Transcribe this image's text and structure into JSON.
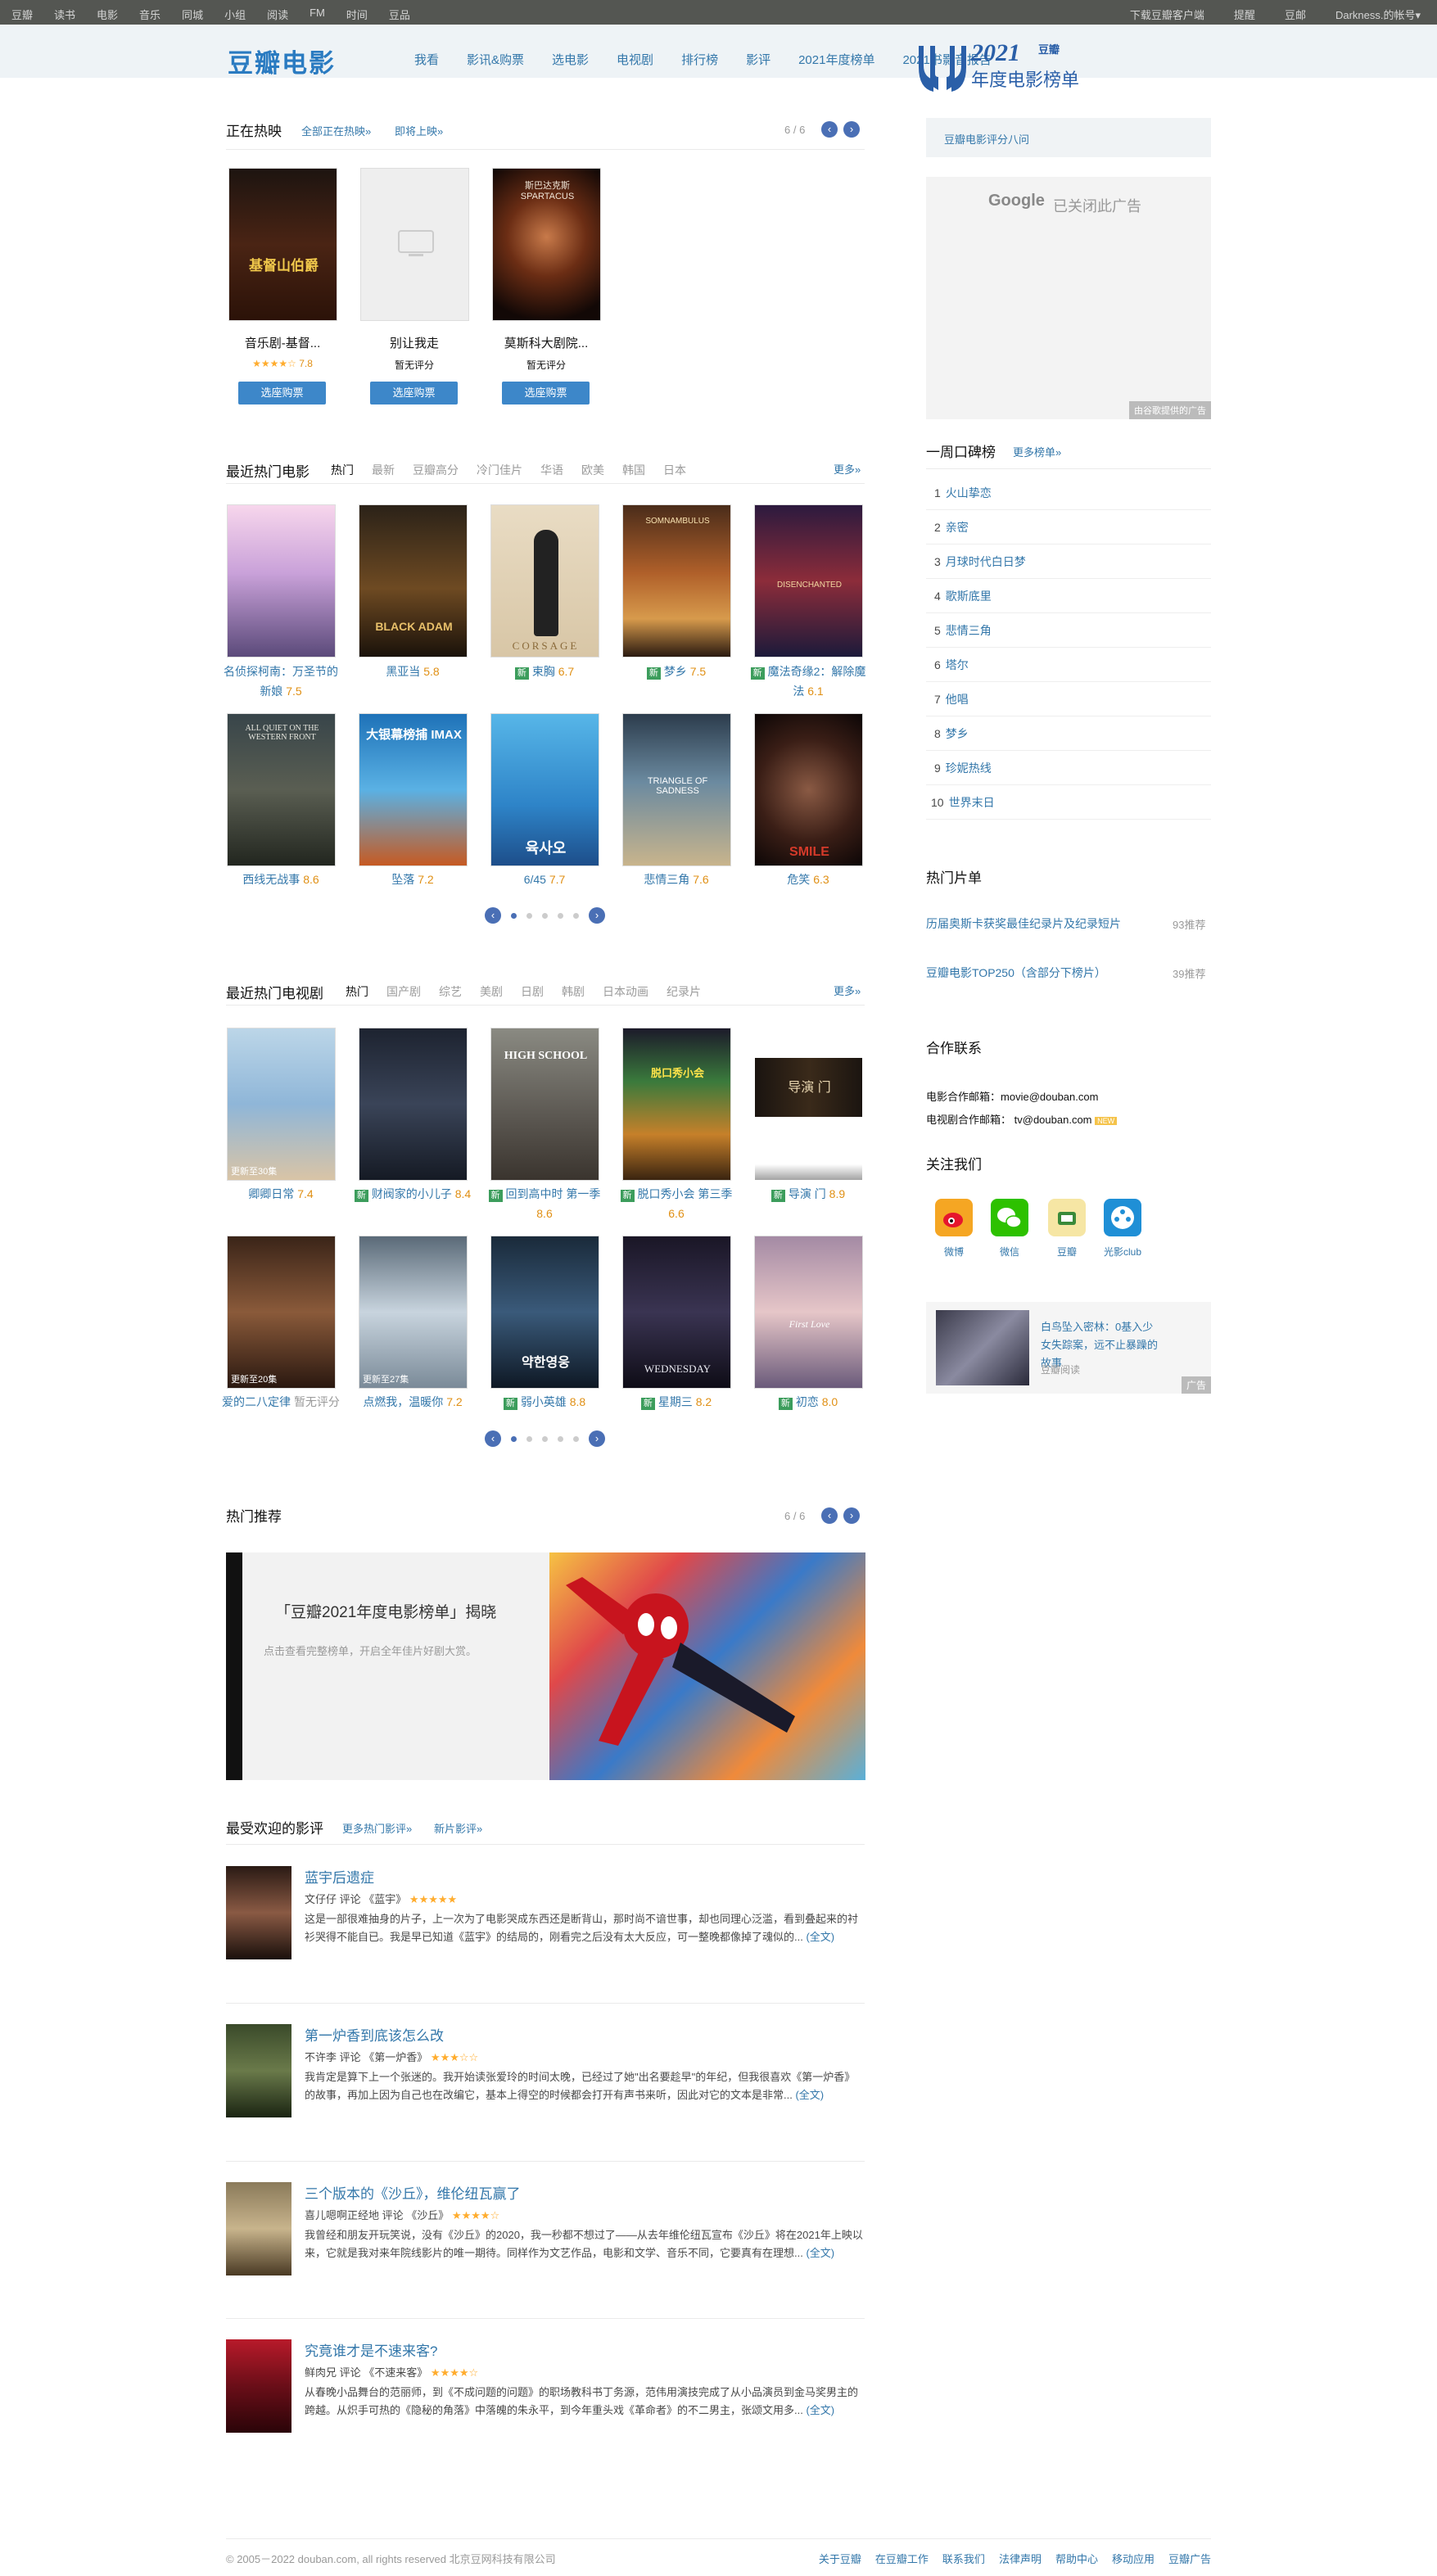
{
  "topbar": {
    "nav": [
      "豆瓣",
      "读书",
      "电影",
      "音乐",
      "同城",
      "小组",
      "阅读",
      "FM",
      "时间",
      "豆品"
    ],
    "right": [
      "下载豆瓣客户端",
      "提醒",
      "豆邮",
      "Darkness.的帐号▾"
    ]
  },
  "header": {
    "logo": "豆瓣电影",
    "nav": [
      "我看",
      "影讯&购票",
      "选电影",
      "电视剧",
      "排行榜",
      "影评",
      "2021年度榜单",
      "2021书影音报告"
    ],
    "year_logo_top": "2021",
    "year_logo_brand": "豆瓣",
    "year_logo_bottom": "年度电影榜单"
  },
  "now_playing": {
    "title": "正在热映",
    "links": [
      "全部正在热映»",
      "即将上映»"
    ],
    "pager": "6 / 6",
    "items": [
      {
        "title": "音乐剧-基督...",
        "stars": "★★★★☆",
        "rating": "7.8",
        "button": "选座购票"
      },
      {
        "title": "别让我走",
        "rating_text": "暂无评分",
        "button": "选座购票"
      },
      {
        "title": "莫斯科大剧院...",
        "rating_text": "暂无评分",
        "button": "选座购票"
      }
    ],
    "poster_texts": [
      "基督山伯爵",
      "",
      "斯巴达克斯 SPARTACUS"
    ]
  },
  "hot_movies": {
    "title": "最近热门电影",
    "tabs": [
      "热门",
      "最新",
      "豆瓣高分",
      "冷门佳片",
      "华语",
      "欧美",
      "韩国",
      "日本"
    ],
    "more": "更多»",
    "new_tag": "新",
    "items": [
      {
        "title": "名侦探柯南：万圣节的新娘",
        "rating": "7.5",
        "new": false
      },
      {
        "title": "黑亚当",
        "rating": "5.8",
        "new": false
      },
      {
        "title": "束胸",
        "rating": "6.7",
        "new": true
      },
      {
        "title": "梦乡",
        "rating": "7.5",
        "new": true
      },
      {
        "title": "魔法奇缘2：解除魔法",
        "rating": "6.1",
        "new": true
      },
      {
        "title": "西线无战事",
        "rating": "8.6",
        "new": false
      },
      {
        "title": "坠落",
        "rating": "7.2",
        "new": false
      },
      {
        "title": "6/45",
        "rating": "7.7",
        "new": false
      },
      {
        "title": "悲情三角",
        "rating": "7.6",
        "new": false
      },
      {
        "title": "危笑",
        "rating": "6.3",
        "new": false
      }
    ],
    "poster_texts": [
      "",
      "BLACK ADAM",
      "CORSAGE",
      "SOMNAMBULUS",
      "DISENCHANTED",
      "ALL QUIET ON THE WESTERN FRONT",
      "大银幕榜捕 IMAX",
      "육사오",
      "TRIANGLE OF SADNESS",
      "SMILE"
    ]
  },
  "hot_tv": {
    "title": "最近热门电视剧",
    "tabs": [
      "热门",
      "国产剧",
      "综艺",
      "美剧",
      "日剧",
      "韩剧",
      "日本动画",
      "纪录片"
    ],
    "more": "更多»",
    "new_tag": "新",
    "items": [
      {
        "title": "卿卿日常",
        "rating": "7.4",
        "new": false
      },
      {
        "title": "财阀家的小儿子",
        "rating": "8.4",
        "new": true
      },
      {
        "title": "回到高中时 第一季",
        "rating": "8.6",
        "new": true
      },
      {
        "title": "脱口秀小会 第三季",
        "rating": "6.6",
        "new": true
      },
      {
        "title": "导演 门",
        "rating": "8.9",
        "new": true
      },
      {
        "title": "爱的二八定律",
        "rating_text": "暂无评分",
        "new": false
      },
      {
        "title": "点燃我，温暖你",
        "rating": "7.2",
        "new": false
      },
      {
        "title": "弱小英雄",
        "rating": "8.8",
        "new": true
      },
      {
        "title": "星期三",
        "rating": "8.2",
        "new": true
      },
      {
        "title": "初恋",
        "rating": "8.0",
        "new": true
      }
    ],
    "poster_texts": [
      "更新至30集",
      "",
      "HIGH SCHOOL",
      "脱口秀小会",
      "导演 门",
      "更新至20集",
      "更新至27集",
      "약한영웅",
      "WEDNESDAY",
      "First Love"
    ]
  },
  "recommend": {
    "title": "热门推荐",
    "pager": "6 / 6",
    "banner_title": "「豆瓣2021年度电影榜单」揭晓",
    "banner_sub": "点击查看完整榜单，开启全年佳片好剧大赏。"
  },
  "reviews": {
    "title": "最受欢迎的影评",
    "links": [
      "更多热门影评»",
      "新片影评»"
    ],
    "items": [
      {
        "title": "蓝宇后遗症",
        "author": "文仔仔",
        "verb": "评论",
        "movie": "《蓝宇》",
        "stars": "★★★★★",
        "text": "这是一部很难抽身的片子，上一次为了电影哭成东西还是断背山，那时尚不谙世事，却也同理心泛滥，看到叠起来的衬衫哭得不能自已。我是早已知道《蓝宇》的结局的，刚看完之后没有太大反应，可一整晚都像掉了魂似的...",
        "full": "(全文)"
      },
      {
        "title": "第一炉香到底该怎么改",
        "author": "不许李",
        "verb": "评论",
        "movie": "《第一炉香》",
        "stars": "★★★☆☆",
        "text": "我肯定是算下上一个张迷的。我开始读张爱玲的时间太晚，已经过了她\"出名要趁早\"的年纪，但我很喜欢《第一炉香》的故事，再加上因为自己也在改编它，基本上得空的时候都会打开有声书来听，因此对它的文本是非常...",
        "full": "(全文)"
      },
      {
        "title": "三个版本的《沙丘》，维伦纽瓦赢了",
        "author": "喜儿嗯啊正经地",
        "verb": "评论",
        "movie": "《沙丘》",
        "stars": "★★★★☆",
        "text": "我曾经和朋友开玩笑说，没有《沙丘》的2020，我一秒都不想过了——从去年维伦纽瓦宣布《沙丘》将在2021年上映以来，它就是我对来年院线影片的唯一期待。同样作为文艺作品，电影和文学、音乐不同，它要真有在理想...",
        "full": "(全文)"
      },
      {
        "title": "究竟谁才是不速来客?",
        "author": "鲜肉兄",
        "verb": "评论",
        "movie": "《不速来客》",
        "stars": "★★★★☆",
        "text": "从春晚小品舞台的范丽师，到《不成问题的问题》的职场教科书丁务源，范伟用演技完成了从小品演员到金马奖男主的跨越。从炽手可热的《隐秘的角落》中落魄的朱永平，到今年重头戏《革命者》的不二男主，张颂文用多...",
        "full": "(全文)"
      }
    ]
  },
  "sidebar": {
    "banner_text": "豆瓣电影评分八问",
    "ad_google": "Google",
    "ad_closed": "已关闭此广告",
    "ad_provider": "由谷歌提供的广告",
    "weekly_title": "一周口碑榜",
    "weekly_more": "更多榜单»",
    "weekly": [
      "火山挚恋",
      "亲密",
      "月球时代白日梦",
      "歌斯底里",
      "悲情三角",
      "塔尔",
      "他唱",
      "梦乡",
      "珍妮热线",
      "世界末日"
    ],
    "hot_lists_title": "热门片单",
    "hot_lists": [
      {
        "name": "历届奥斯卡获奖最佳纪录片及纪录短片",
        "count": "93推荐"
      },
      {
        "name": "豆瓣电影TOP250（含部分下榜片）",
        "count": "39推荐"
      }
    ],
    "contact_title": "合作联系",
    "contact_movie_label": "电影合作邮箱：",
    "contact_movie": "movie@douban.com",
    "contact_tv_label": "电视剧合作邮箱：",
    "contact_tv": "tv@douban.com",
    "contact_tv_badge": "NEW",
    "follow_title": "关注我们",
    "follow": [
      "微博",
      "微信",
      "豆瓣",
      "光影club"
    ],
    "ad2_text": "白鸟坠入密林：0基入少女失踪案，远不止暴躁的故事",
    "ad2_source": "豆瓣阅读",
    "ad2_tag": "广告"
  },
  "footer": {
    "copyright": "© 2005－2022 douban.com, all rights reserved 北京豆网科技有限公司",
    "links": [
      "关于豆瓣",
      "在豆瓣工作",
      "联系我们",
      "法律声明",
      "帮助中心",
      "移动应用",
      "豆瓣广告"
    ]
  },
  "colors": {
    "link": "#3377aa",
    "rating": "#e09015",
    "accent": "#4a6fb5",
    "new_tag": "#3c9d5c",
    "buy": "#3d87c9"
  }
}
